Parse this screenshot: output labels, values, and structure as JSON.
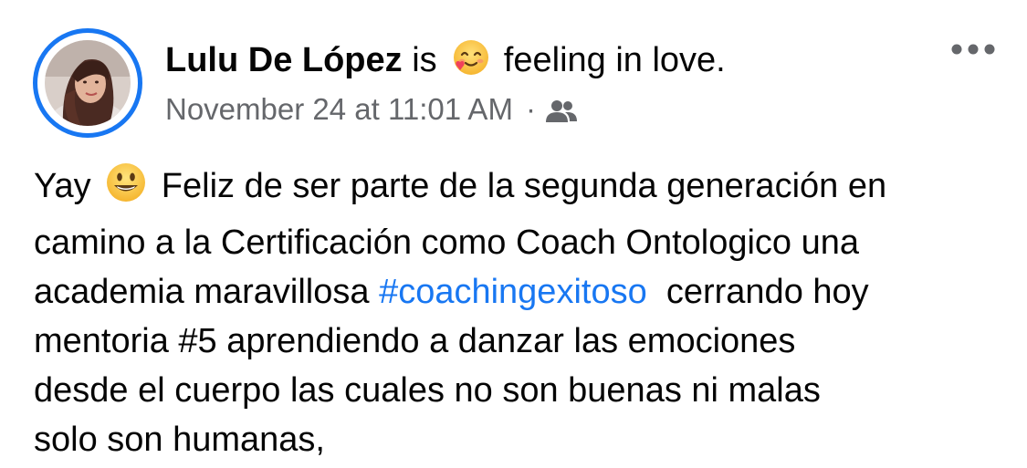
{
  "post": {
    "author": "Lulu De López",
    "activity_prefix": "is",
    "activity_emoji": "smiling-face-with-heart-icon",
    "activity_text": "feeling in love.",
    "timestamp": "November 24 at 11:01 AM",
    "separator": "·",
    "audience_icon": "friends-icon",
    "more_icon": "more-options-icon",
    "body_lines": [
      "Feliz de ser parte de la segunda generación en",
      "camino a la Certificación como Coach Ontologico una",
      "academia maravillosa",
      "cerrando hoy",
      "mentoria #5 aprendiendo a danzar las emociones",
      "desde el cuerpo las cuales no son buenas ni malas",
      "solo son humanas,"
    ],
    "body_start": "Yay",
    "body_emoji": "grinning-face-icon",
    "hashtag": "#coachingexitoso",
    "colors": {
      "link": "#1877f2",
      "avatar_ring": "#1877f2",
      "secondary_text": "#65676b",
      "primary_text": "#050505"
    }
  }
}
